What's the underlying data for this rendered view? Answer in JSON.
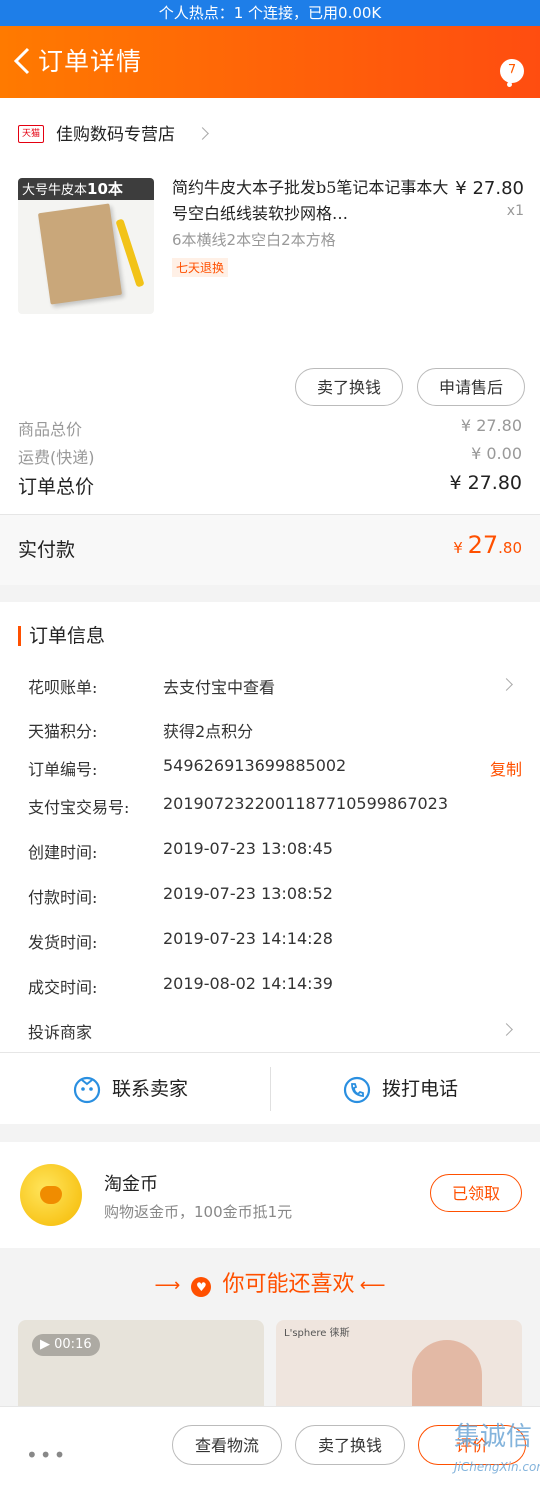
{
  "status_bar": {
    "text": "个人热点：1 个连接，已用0.00K"
  },
  "header": {
    "title": "订单详情",
    "badge": "7"
  },
  "shop": {
    "logo": "天猫",
    "name": "佳购数码专营店"
  },
  "product": {
    "image_tag_prefix": "大号牛皮本",
    "image_tag_count": "10本",
    "title": "简约牛皮大本子批发b5笔记本记事本大号空白纸线装软抄网格…",
    "price": "¥ 27.80",
    "qty": "x1",
    "sku": "6本横线2本空白2本方格",
    "tag": "七天退换"
  },
  "product_actions": {
    "sell": "卖了换钱",
    "aftersale": "申请售后"
  },
  "summary": {
    "goods_label": "商品总价",
    "goods_value": "¥ 27.80",
    "freight_label": "运费(快递)",
    "freight_value": "¥ 0.00",
    "total_label": "订单总价",
    "total_value": "¥ 27.80",
    "paid_label": "实付款",
    "paid_symbol": "¥ ",
    "paid_int": "27",
    "paid_dec": ".80"
  },
  "order_info": {
    "title": "订单信息",
    "rows": [
      {
        "key": "花呗账单:",
        "value": "去支付宝中查看"
      },
      {
        "key": "天猫积分:",
        "value": "获得2点积分"
      },
      {
        "key": "订单编号:",
        "value": "549626913699885002",
        "action": "复制"
      },
      {
        "key": "支付宝交易号:",
        "value": "2019072322001187710599867023"
      },
      {
        "key": "创建时间:",
        "value": "2019-07-23 13:08:45"
      },
      {
        "key": "付款时间:",
        "value": "2019-07-23 13:08:52"
      },
      {
        "key": "发货时间:",
        "value": "2019-07-23 14:14:28"
      },
      {
        "key": "成交时间:",
        "value": "2019-08-02 14:14:39"
      }
    ],
    "complain": "投诉商家"
  },
  "contact": {
    "seller": "联系卖家",
    "call": "拨打电话"
  },
  "coin": {
    "name": "淘金币",
    "desc": "购物返金币，100金币抵1元",
    "button": "已领取"
  },
  "recommend": {
    "title": "你可能还喜欢",
    "video_time": "00:16",
    "brand2": "L'sphere 徕斯"
  },
  "bottom_bar": {
    "logistics": "查看物流",
    "sell": "卖了换钱",
    "review": "评价"
  },
  "watermark": {
    "text": "集诚信",
    "url": "JiChengXin.com"
  }
}
